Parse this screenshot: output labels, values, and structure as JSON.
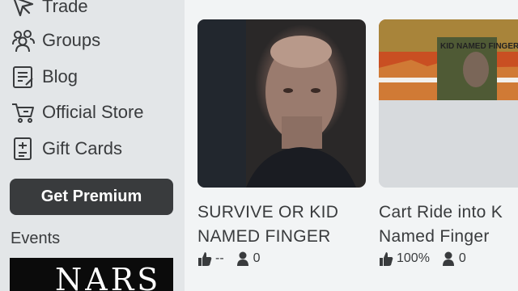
{
  "sidebar": {
    "items": [
      {
        "label": "Trade",
        "icon": "trade-icon"
      },
      {
        "label": "Groups",
        "icon": "groups-icon"
      },
      {
        "label": "Blog",
        "icon": "blog-icon"
      },
      {
        "label": "Official Store",
        "icon": "store-cart-icon"
      },
      {
        "label": "Gift Cards",
        "icon": "gift-card-icon"
      }
    ],
    "premium_button": "Get Premium",
    "events_label": "Events",
    "events_banner_text": "NARS"
  },
  "games": [
    {
      "title_line1": "SURVIVE OR KID",
      "title_line2": "NAMED FINGER",
      "rating": "--",
      "players": "0"
    },
    {
      "title_line1": "Cart Ride into K",
      "title_line2": "Named Finger",
      "rating": "100%",
      "players": "0",
      "thumb_text": "KID NAMED FINGER"
    }
  ],
  "colors": {
    "sidebar_bg": "#e3e6e8",
    "page_bg": "#f2f4f5",
    "text": "#393b3d",
    "button_bg": "#393b3d"
  }
}
